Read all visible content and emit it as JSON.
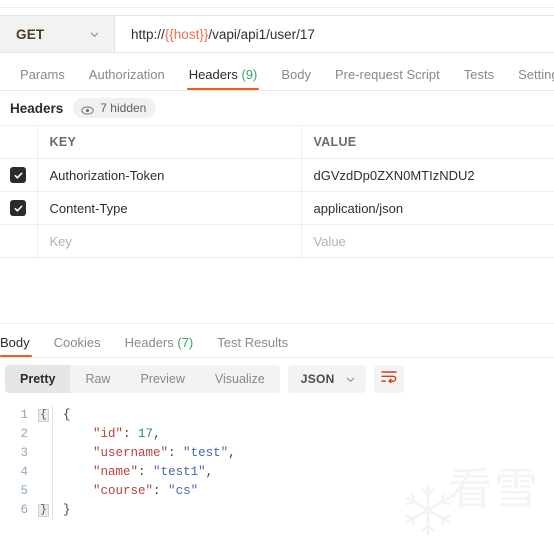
{
  "request": {
    "method": "GET",
    "method_caret_icon": "chevron-down-icon",
    "url_prefix": "http://",
    "url_variable": "{{host}}",
    "url_suffix": "/vapi/api1/user/17",
    "url_full": "http://{{host}}/vapi/api1/user/17",
    "tabs": [
      {
        "label": "Params",
        "count": "",
        "active": false
      },
      {
        "label": "Authorization",
        "count": "",
        "active": false
      },
      {
        "label": "Headers",
        "count": "(9)",
        "active": true
      },
      {
        "label": "Body",
        "count": "",
        "active": false
      },
      {
        "label": "Pre-request Script",
        "count": "",
        "active": false
      },
      {
        "label": "Tests",
        "count": "",
        "active": false
      },
      {
        "label": "Settings",
        "count": "",
        "active": false
      }
    ]
  },
  "headers_panel": {
    "title": "Headers",
    "hidden_pill": {
      "icon": "eye-icon",
      "label": "7 hidden"
    },
    "columns": [
      "KEY",
      "VALUE"
    ],
    "rows": [
      {
        "checked": true,
        "key": "Authorization-Token",
        "value": "dGVzdDp0ZXN0MTIzNDU2"
      },
      {
        "checked": true,
        "key": "Content-Type",
        "value": "application/json"
      }
    ],
    "new_row": {
      "key_placeholder": "Key",
      "value_placeholder": "Value"
    }
  },
  "response": {
    "tabs": [
      {
        "label": "Body",
        "count": "",
        "active": true
      },
      {
        "label": "Cookies",
        "count": "",
        "active": false
      },
      {
        "label": "Headers",
        "count": "(7)",
        "active": false
      },
      {
        "label": "Test Results",
        "count": "",
        "active": false
      }
    ],
    "view_modes": [
      {
        "label": "Pretty",
        "active": true
      },
      {
        "label": "Raw",
        "active": false
      },
      {
        "label": "Preview",
        "active": false
      },
      {
        "label": "Visualize",
        "active": false
      }
    ],
    "format_select": {
      "value": "JSON",
      "caret_icon": "chevron-down-icon"
    },
    "wrap_button_icon": "word-wrap-icon",
    "body_json": {
      "id": 17,
      "username": "test",
      "name": "test1",
      "course": "cs"
    },
    "line_numbers": [
      "1",
      "2",
      "3",
      "4",
      "5",
      "6"
    ],
    "code_lines": [
      {
        "n": "1",
        "text": "{"
      },
      {
        "n": "2",
        "text": "    \"id\": 17,"
      },
      {
        "n": "3",
        "text": "    \"username\": \"test\","
      },
      {
        "n": "4",
        "text": "    \"name\": \"test1\","
      },
      {
        "n": "5",
        "text": "    \"course\": \"cs\""
      },
      {
        "n": "6",
        "text": "}"
      }
    ],
    "fold_marks": {
      "open": "{",
      "close": "}"
    }
  },
  "watermark": {
    "text": "看雪",
    "icon": "snowflake-icon"
  },
  "colors": {
    "accent_orange": "#ef5b25",
    "count_green": "#3aa06a",
    "variable_orange": "#f06f4b",
    "json_key": "#b5443a",
    "json_string": "#4169b5",
    "json_number": "#2a8f5e",
    "checkbox_fill": "#2b2b2b"
  }
}
